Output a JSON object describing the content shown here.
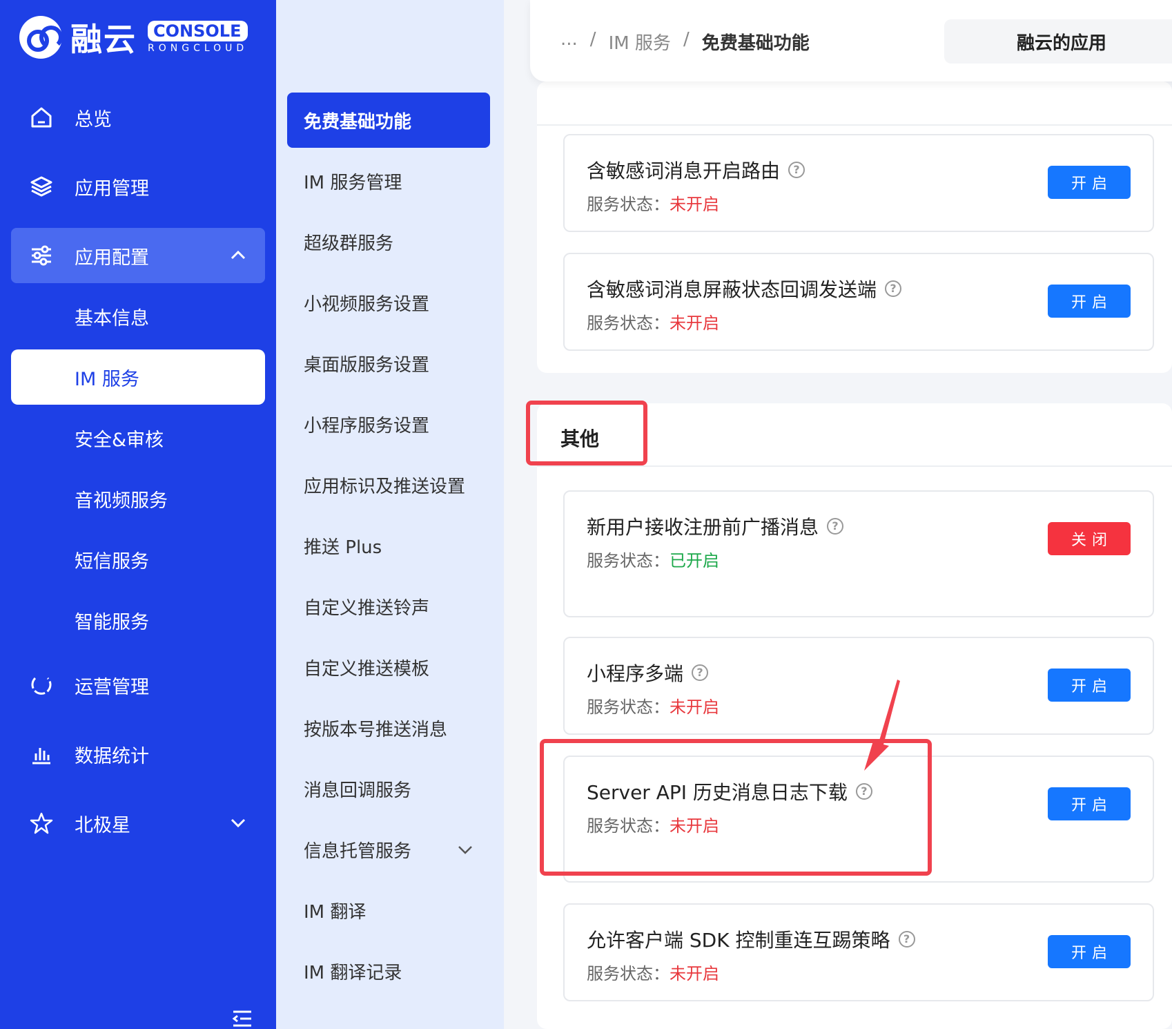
{
  "logo": {
    "brand": "融云",
    "console": "CONSOLE",
    "sub": "RONGCLOUD"
  },
  "sidebar": {
    "items": [
      {
        "label": "总览"
      },
      {
        "label": "应用管理"
      },
      {
        "label": "应用配置",
        "expanded": true
      },
      {
        "label": "运营管理"
      },
      {
        "label": "数据统计"
      },
      {
        "label": "北极星",
        "expanded": false
      }
    ],
    "sub_items": [
      {
        "label": "基本信息"
      },
      {
        "label": "IM 服务",
        "active": true
      },
      {
        "label": "安全&审核"
      },
      {
        "label": "音视频服务"
      },
      {
        "label": "短信服务"
      },
      {
        "label": "智能服务"
      }
    ]
  },
  "menu2": {
    "items": [
      {
        "label": "免费基础功能",
        "active": true
      },
      {
        "label": "IM 服务管理"
      },
      {
        "label": "超级群服务"
      },
      {
        "label": "小视频服务设置"
      },
      {
        "label": "桌面版服务设置"
      },
      {
        "label": "小程序服务设置"
      },
      {
        "label": "应用标识及推送设置"
      },
      {
        "label": "推送 Plus"
      },
      {
        "label": "自定义推送铃声"
      },
      {
        "label": "自定义推送模板"
      },
      {
        "label": "按版本号推送消息"
      },
      {
        "label": "消息回调服务"
      },
      {
        "label": "信息托管服务"
      },
      {
        "label": "IM 翻译"
      },
      {
        "label": "IM 翻译记录"
      }
    ]
  },
  "breadcrumb": {
    "ellipsis": "...",
    "sep": "/",
    "parent": "IM 服务",
    "current": "免费基础功能"
  },
  "app_selector": {
    "label": "融云的应用"
  },
  "sections": {
    "other_title": "其他"
  },
  "status_prefix": "服务状态：",
  "cards": [
    {
      "title": "含敏感词消息开启路由",
      "status": "未开启",
      "button": "开启"
    },
    {
      "title": "含敏感词消息屏蔽状态回调发送端",
      "status": "未开启",
      "button": "开启"
    },
    {
      "title": "新用户接收注册前广播消息",
      "status": "已开启",
      "button": "关闭"
    },
    {
      "title": "小程序多端",
      "status": "未开启",
      "button": "开启"
    },
    {
      "title": "Server API 历史消息日志下载",
      "status": "未开启",
      "button": "开启"
    },
    {
      "title": "允许客户端 SDK 控制重连互踢策略",
      "status": "未开启",
      "button": "开启"
    }
  ],
  "colors": {
    "primary": "#1e40e6",
    "button_blue": "#1677ff",
    "button_red": "#f5333f",
    "status_off": "#e8383d",
    "status_on": "#1ca84a",
    "highlight": "#f0424e"
  },
  "icons": {
    "help": "?"
  }
}
